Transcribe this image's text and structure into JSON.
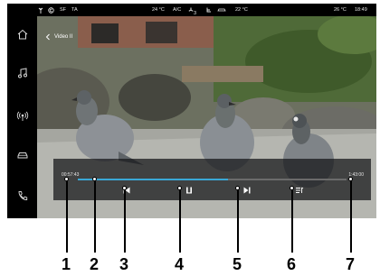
{
  "status_bar": {
    "indicators": [
      "SF",
      "TA"
    ],
    "inside_temp": "24 °C",
    "ac": "A/C",
    "fan": "3",
    "outside_temp": "22 °C",
    "right_temp": "26 °C",
    "clock": "18:49"
  },
  "sidebar": {
    "items": [
      {
        "name": "home",
        "icon": "home-icon"
      },
      {
        "name": "music",
        "icon": "music-note-icon"
      },
      {
        "name": "radio",
        "icon": "radio-antenna-icon"
      },
      {
        "name": "car",
        "icon": "car-icon"
      },
      {
        "name": "phone",
        "icon": "phone-icon"
      }
    ]
  },
  "video": {
    "back_label": "Video II"
  },
  "player": {
    "elapsed": "00:57:43",
    "total": "1:43:00",
    "progress": 0.56,
    "accent_color": "#3aa8d6"
  },
  "callouts": [
    "1",
    "2",
    "3",
    "4",
    "5",
    "6",
    "7"
  ]
}
